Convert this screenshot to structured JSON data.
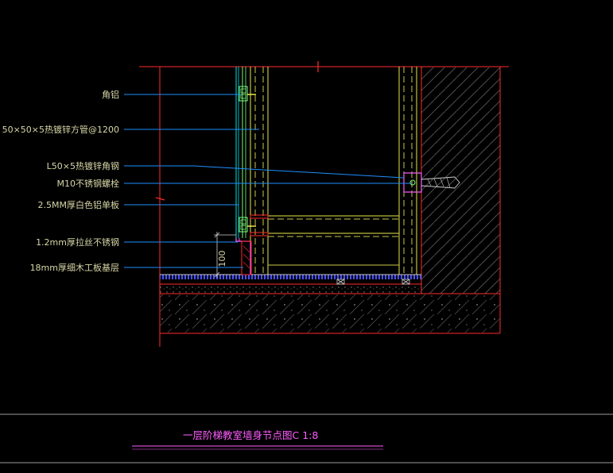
{
  "drawing": {
    "callouts": [
      {
        "id": "corner",
        "text": "角铝"
      },
      {
        "id": "tube",
        "text": "50×50×5热镀锌方管@1200"
      },
      {
        "id": "angle",
        "text": "L50×5热镀锌角钢"
      },
      {
        "id": "bolt",
        "text": "M10不锈钢螺栓"
      },
      {
        "id": "panel",
        "text": "2.5MM厚白色铝单板"
      },
      {
        "id": "steel",
        "text": "1.2mm厚拉丝不锈钢"
      },
      {
        "id": "board",
        "text": "18mm厚细木工板基层"
      }
    ],
    "dimension_text": "100",
    "title": "一层阶梯教室墙身节点图C 1:8"
  },
  "colors": {
    "background": "#000000",
    "leader": "#1e90ff",
    "outline": "#ff2a2a",
    "structure": "#e8e84a",
    "frame": "#7cff7c",
    "panel": "#00e5e5",
    "accent": "#ff5cff",
    "paving": "#4a52ff",
    "hatch": "#5a5a5a",
    "text": "#d7d7a8"
  }
}
